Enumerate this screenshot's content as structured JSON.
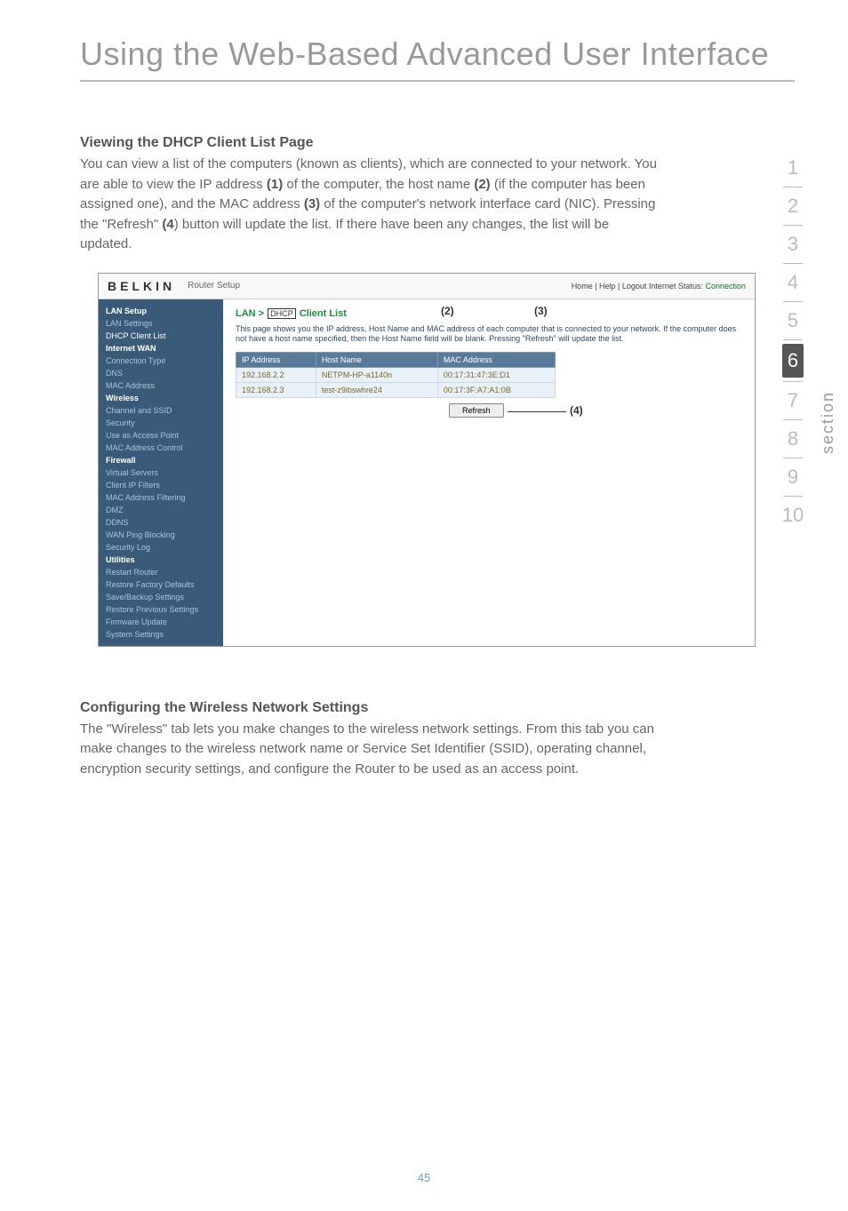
{
  "page": {
    "title": "Using the Web-Based Advanced User Interface",
    "number": "45",
    "section_label": "section"
  },
  "sec1": {
    "heading": "Viewing the DHCP Client List Page",
    "p1a": "You can view a list of the computers (known as clients), which are connected to your network. You are able to view the IP address ",
    "b1": "(1)",
    "p1b": " of the computer, the host name ",
    "b2": "(2)",
    "p1c": " (if the computer has been assigned one), and the MAC address ",
    "b3": "(3)",
    "p1d": " of the computer's network interface card (NIC). Pressing the \"Refresh\" ",
    "b4": "(4",
    "p1e": ") button will update the list. If there have been any changes, the list will be updated."
  },
  "sec2": {
    "heading": "Configuring the Wireless Network Settings",
    "body": "The \"Wireless\" tab lets you make changes to the wireless network settings. From this tab you can make changes to the wireless network name or Service Set Identifier (SSID), operating channel, encryption security settings, and configure the Router to be used as an access point."
  },
  "app": {
    "logo": "BELKIN",
    "sub": "Router Setup",
    "status_prefix": "Home | Help | Logout   Internet Status: ",
    "status_value": "Connection",
    "crumb_a": "LAN > ",
    "crumb_box1": "DHCP",
    "crumb_b": " Client List",
    "crumb_box2": "(2)",
    "annot3": "(3)",
    "annot4": "(4)",
    "desc": "This page shows you the IP address, Host Name and MAC address of each computer that is connected to your network. If the computer does not have a host name specified, then the Host Name field will be blank. Pressing \"Refresh\" will update the list.",
    "th1": "IP Address",
    "th2": "Host Name",
    "th3": "MAC Address",
    "rows": [
      {
        "ip": "192.168.2.2",
        "host": "NETPM-HP-a1140n",
        "mac": "00:17:31:47:3E:D1"
      },
      {
        "ip": "192.168.2.3",
        "host": "test-z9ibswhre24",
        "mac": "00:17:3F:A7:A1:0B"
      }
    ],
    "refresh": "Refresh",
    "sidebar": {
      "g1": "LAN Setup",
      "i1": "LAN Settings",
      "i2": "DHCP Client List",
      "g2": "Internet WAN",
      "i3": "Connection Type",
      "i4": "DNS",
      "i5": "MAC Address",
      "g3": "Wireless",
      "i6": "Channel and SSID",
      "i7": "Security",
      "i8": "Use as Access Point",
      "i9": "MAC Address Control",
      "g4": "Firewall",
      "i10": "Virtual Servers",
      "i11": "Client IP Filters",
      "i12": "MAC Address Filtering",
      "i13": "DMZ",
      "i14": "DDNS",
      "i15": "WAN Ping Blocking",
      "i16": "Security Log",
      "g5": "Utilities",
      "i17": "Restart Router",
      "i18": "Restore Factory Defaults",
      "i19": "Save/Backup Settings",
      "i20": "Restore Previous Settings",
      "i21": "Firmware Update",
      "i22": "System Settings"
    }
  },
  "nav": {
    "1": "1",
    "2": "2",
    "3": "3",
    "4": "4",
    "5": "5",
    "6": "6",
    "7": "7",
    "8": "8",
    "9": "9",
    "10": "10"
  }
}
